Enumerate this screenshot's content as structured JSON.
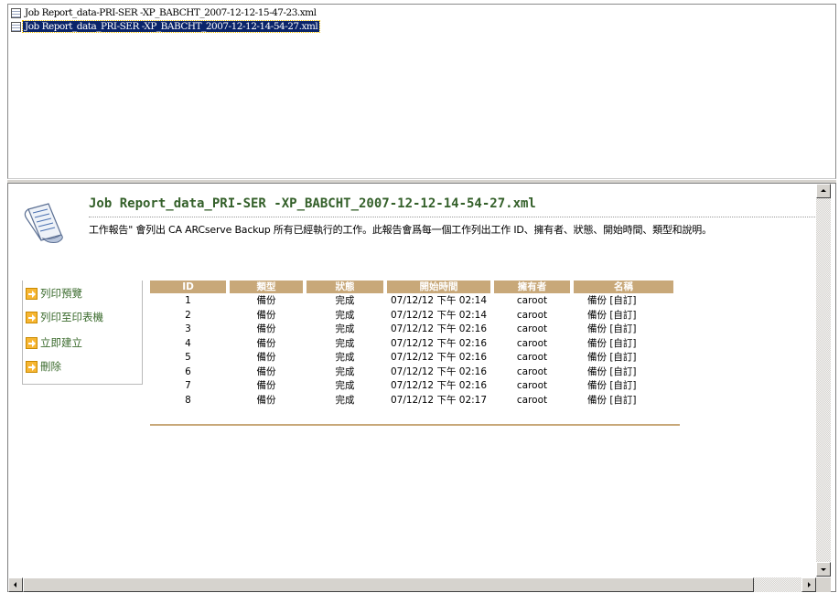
{
  "file_list": [
    {
      "name": "Job Report_data-PRI-SER -XP_BABCHT_2007-12-12-15-47-23.xml",
      "selected": false
    },
    {
      "name": "Job Report_data_PRI-SER -XP_BABCHT_2007-12-12-14-54-27.xml",
      "selected": true
    }
  ],
  "report": {
    "title": "Job Report_data_PRI-SER -XP_BABCHT_2007-12-12-14-54-27.xml",
    "description": "工作報告\" 會列出 CA ARCserve Backup 所有已經執行的工作。此報告會爲每一個工作列出工作 ID、擁有者、狀態、開始時間、類型和說明。"
  },
  "actions": [
    {
      "label": "列印預覽",
      "icon": "arrow-right-icon"
    },
    {
      "label": "列印至印表機",
      "icon": "arrow-right-icon"
    },
    {
      "label": "立即建立",
      "icon": "arrow-right-icon"
    },
    {
      "label": "刪除",
      "icon": "arrow-right-icon"
    }
  ],
  "table": {
    "headers": [
      "ID",
      "類型",
      "狀態",
      "開始時間",
      "擁有者",
      "名稱"
    ],
    "rows": [
      [
        "1",
        "備份",
        "完成",
        "07/12/12 下午 02:14",
        "caroot",
        "備份 [自訂]"
      ],
      [
        "2",
        "備份",
        "完成",
        "07/12/12 下午 02:14",
        "caroot",
        "備份 [自訂]"
      ],
      [
        "3",
        "備份",
        "完成",
        "07/12/12 下午 02:16",
        "caroot",
        "備份 [自訂]"
      ],
      [
        "4",
        "備份",
        "完成",
        "07/12/12 下午 02:16",
        "caroot",
        "備份 [自訂]"
      ],
      [
        "5",
        "備份",
        "完成",
        "07/12/12 下午 02:16",
        "caroot",
        "備份 [自訂]"
      ],
      [
        "6",
        "備份",
        "完成",
        "07/12/12 下午 02:16",
        "caroot",
        "備份 [自訂]"
      ],
      [
        "7",
        "備份",
        "完成",
        "07/12/12 下午 02:16",
        "caroot",
        "備份 [自訂]"
      ],
      [
        "8",
        "備份",
        "完成",
        "07/12/12 下午 02:17",
        "caroot",
        "備份 [自訂]"
      ]
    ]
  },
  "colors": {
    "title_green": "#34602a",
    "header_tan": "#c8a879",
    "selection_blue": "#0a246a"
  }
}
